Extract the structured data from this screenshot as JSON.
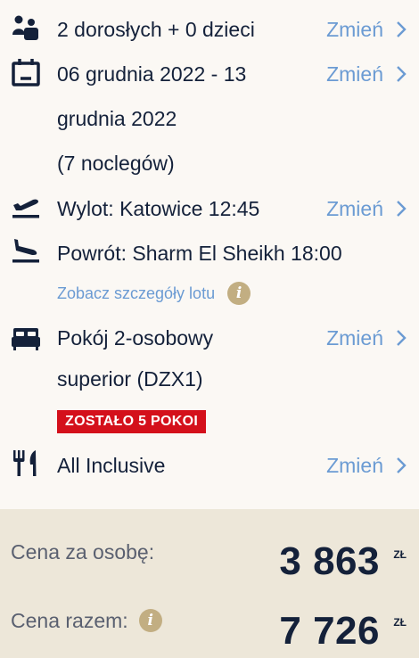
{
  "guests": {
    "icon": "family-icon",
    "text": "2 dorosłych + 0 dzieci",
    "change": "Zmień"
  },
  "dates": {
    "icon": "calendar-icon",
    "line1": "06 grudnia 2022 - 13",
    "line2": "grudnia 2022",
    "line3": "(7 noclegów)",
    "change": "Zmień"
  },
  "departure": {
    "icon": "plane-takeoff-icon",
    "text": "Wylot: Katowice 12:45",
    "change": "Zmień"
  },
  "return_flight": {
    "icon": "plane-landing-icon",
    "text": "Powrót: Sharm El Sheikh 18:00"
  },
  "flight_details_link": "Zobacz szczegóły lotu",
  "room": {
    "icon": "bed-icon",
    "line1": "Pokój 2-osobowy",
    "line2": "superior (DZX1)",
    "badge": "ZOSTAŁO 5 POKOI",
    "change": "Zmień"
  },
  "board": {
    "icon": "fork-knife-icon",
    "text": "All Inclusive",
    "change": "Zmień"
  },
  "price": {
    "per_person_label": "Cena za osobę:",
    "per_person_value": "3 863",
    "total_label": "Cena razem:",
    "total_value": "7 726",
    "currency": "ZŁ"
  },
  "colors": {
    "accent": "#6b9bd3",
    "badge": "#d4101b",
    "info": "#c2ae82",
    "text": "#14213a"
  }
}
